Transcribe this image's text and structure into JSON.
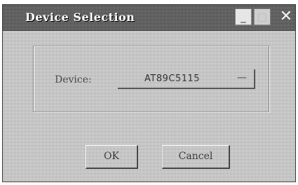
{
  "window": {
    "title": "Device Selection"
  },
  "titlebar_buttons": {
    "minimize": "_",
    "maximize": "□",
    "close": "✕"
  },
  "device": {
    "label": "Device:",
    "value": "AT89C5115",
    "arrow": "—"
  },
  "buttons": {
    "ok": "OK",
    "cancel": "Cancel"
  }
}
